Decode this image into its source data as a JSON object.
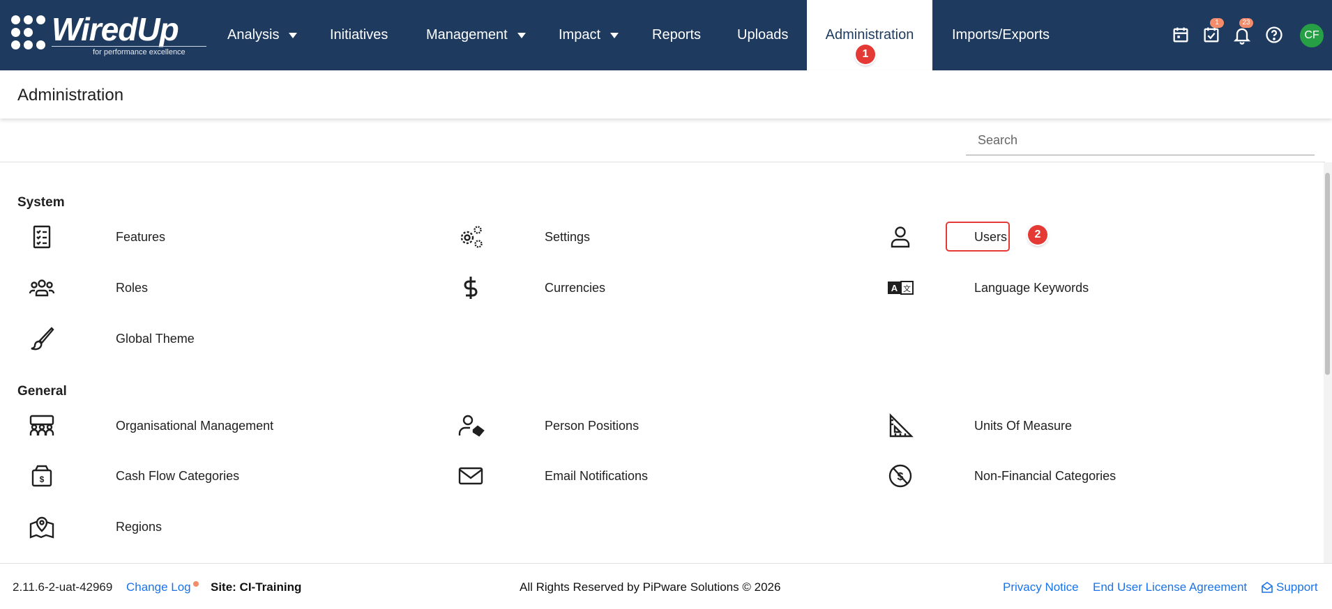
{
  "brand": {
    "name": "WiredUp",
    "tagline": "for performance excellence"
  },
  "nav": {
    "items": [
      {
        "label": "Analysis",
        "has_dropdown": true
      },
      {
        "label": "Initiatives",
        "has_dropdown": false
      },
      {
        "label": "Management",
        "has_dropdown": true
      },
      {
        "label": "Impact",
        "has_dropdown": true
      },
      {
        "label": "Reports",
        "has_dropdown": false
      },
      {
        "label": "Uploads",
        "has_dropdown": false
      },
      {
        "label": "Administration",
        "has_dropdown": false,
        "active": true
      },
      {
        "label": "Imports/Exports",
        "has_dropdown": false
      }
    ],
    "tools": {
      "calendar_icon": "calendar-icon",
      "tasks_icon": "task-check-icon",
      "tasks_count": "1",
      "notifications_icon": "bell-icon",
      "notifications_count": "23",
      "help_icon": "help-circle-icon"
    },
    "avatar_initials": "CF"
  },
  "annotations": {
    "step1": "1",
    "step2": "2"
  },
  "page": {
    "title": "Administration"
  },
  "search": {
    "placeholder": "Search"
  },
  "sections": [
    {
      "title": "System",
      "items": [
        {
          "label": "Features",
          "icon": "checklist-icon"
        },
        {
          "label": "Settings",
          "icon": "gears-icon"
        },
        {
          "label": "Users",
          "icon": "user-icon"
        },
        {
          "label": "Roles",
          "icon": "users-group-icon"
        },
        {
          "label": "Currencies",
          "icon": "dollar-icon"
        },
        {
          "label": "Language Keywords",
          "icon": "translate-icon"
        },
        {
          "label": "Global Theme",
          "icon": "paintbrush-icon"
        }
      ]
    },
    {
      "title": "General",
      "items": [
        {
          "label": "Organisational Management",
          "icon": "org-chart-icon"
        },
        {
          "label": "Person Positions",
          "icon": "person-tag-icon"
        },
        {
          "label": "Units Of Measure",
          "icon": "set-square-icon"
        },
        {
          "label": "Cash Flow Categories",
          "icon": "money-box-icon"
        },
        {
          "label": "Email Notifications",
          "icon": "envelope-icon"
        },
        {
          "label": "Non-Financial Categories",
          "icon": "no-dollar-icon"
        },
        {
          "label": "Regions",
          "icon": "map-pin-icon"
        }
      ]
    }
  ],
  "footer": {
    "version": "2.11.6-2-uat-42969",
    "change_log": "Change Log",
    "site": "Site: CI-Training",
    "copyright": "All Rights Reserved by PiPware Solutions © 2026",
    "privacy": "Privacy Notice",
    "eula": "End User License Agreement",
    "support": "Support"
  },
  "colors": {
    "nav_bg": "#1e3a5f",
    "accent_red": "#e53935",
    "link_blue": "#1a73e8",
    "avatar_green": "#27a045"
  }
}
